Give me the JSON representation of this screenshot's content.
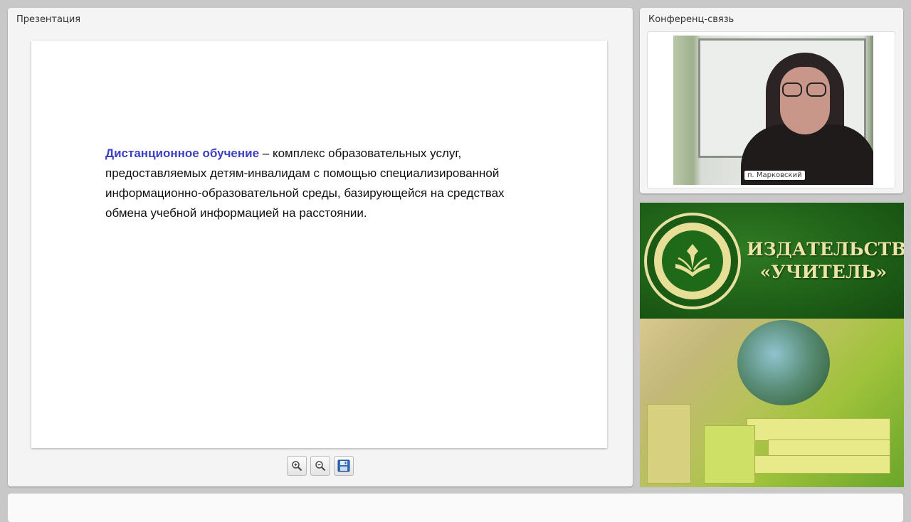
{
  "presentation": {
    "title": "Презентация",
    "slide": {
      "term": "Дистанционное обучение",
      "definition": " – комплекс образовательных услуг, предоставляемых детям-инвалидам с помощью специализированной информационно-образовательной среды, базирующейся на средствах обмена учебной информацией на расстоянии."
    },
    "toolbar": [
      {
        "name": "zoom-in",
        "icon": "zoom-in-icon"
      },
      {
        "name": "zoom-out",
        "icon": "zoom-out-icon"
      },
      {
        "name": "save",
        "icon": "floppy-disk-icon"
      }
    ]
  },
  "conference": {
    "title": "Конференц-связь",
    "participant_name": "п. Марковский"
  },
  "banner": {
    "line1": "ИЗДАТЕЛЬСТВО",
    "line2": "«УЧИТЕЛЬ»"
  },
  "colors": {
    "term": "#3e3ec0",
    "banner_green": "#1e5f17",
    "banner_text": "#ece4a6"
  }
}
